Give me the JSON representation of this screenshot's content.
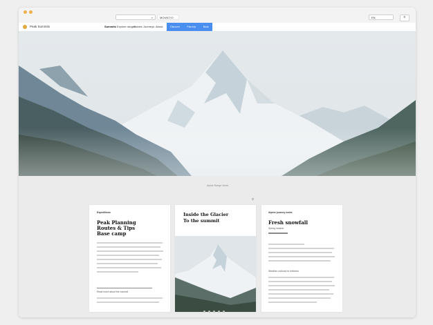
{
  "browser": {
    "url_icon": "search-icon",
    "url_bar_text": "",
    "tab_text": "MOUNT.IO",
    "search_text": "EN",
    "menu_icon": "menu-icon"
  },
  "site_nav": {
    "brand": "Peak Summits",
    "links": [
      "Summits",
      "Explore ranges",
      "Guides",
      "Journeys",
      "About"
    ],
    "cta_links": [
      "Discover",
      "Plan trip",
      "Book"
    ]
  },
  "hero": {
    "caption": "Alpine Range Views"
  },
  "cards": [
    {
      "eyebrow": "Expeditions",
      "title_line1": "Peak Planning",
      "title_line2": "Routes & Tips",
      "title_line3": "Base camp",
      "footer_label": "Read more about the summit"
    },
    {
      "title_line1": "Inside the Glacier",
      "title_line2": "To the summit",
      "image_icon": "mountain-image-icon"
    },
    {
      "eyebrow": "Alpine journey notes",
      "title_line1": "Fresh snowfall",
      "subtitle": "Spring season",
      "section_label": "Weather outlook for trekkers"
    }
  ],
  "colors": {
    "accent": "#4a8ef0",
    "window_bg": "#ffffff",
    "content_bg": "#ebebeb",
    "traffic": "#f1b04a"
  }
}
